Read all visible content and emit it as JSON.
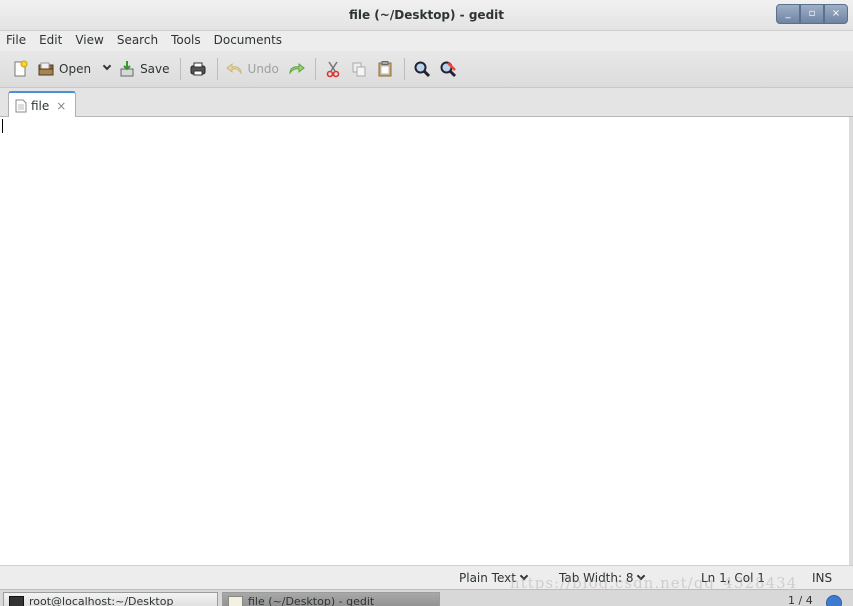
{
  "window": {
    "title": "file (~/Desktop) - gedit"
  },
  "window_buttons": [
    "_",
    "▫",
    "×"
  ],
  "menu": [
    "File",
    "Edit",
    "View",
    "Search",
    "Tools",
    "Documents"
  ],
  "toolbar": {
    "open_label": "Open",
    "save_label": "Save",
    "undo_label": "Undo"
  },
  "tabs": [
    {
      "label": "file",
      "close": "×"
    }
  ],
  "editor": {
    "content": ""
  },
  "status": {
    "language": "Plain Text",
    "tab_width": "Tab Width:  8",
    "position": "Ln 1, Col 1",
    "mode": "INS",
    "watermark": "https://blog.csdn.net/qq_4328434"
  },
  "taskbar": {
    "items": [
      "root@localhost:~/Desktop",
      "file (~/Desktop) - gedit"
    ],
    "pager": "1 / 4"
  },
  "colors": {
    "tab_accent": "#4a90d9",
    "window_buttons": "#7c8fac",
    "background": "#ffffff"
  }
}
